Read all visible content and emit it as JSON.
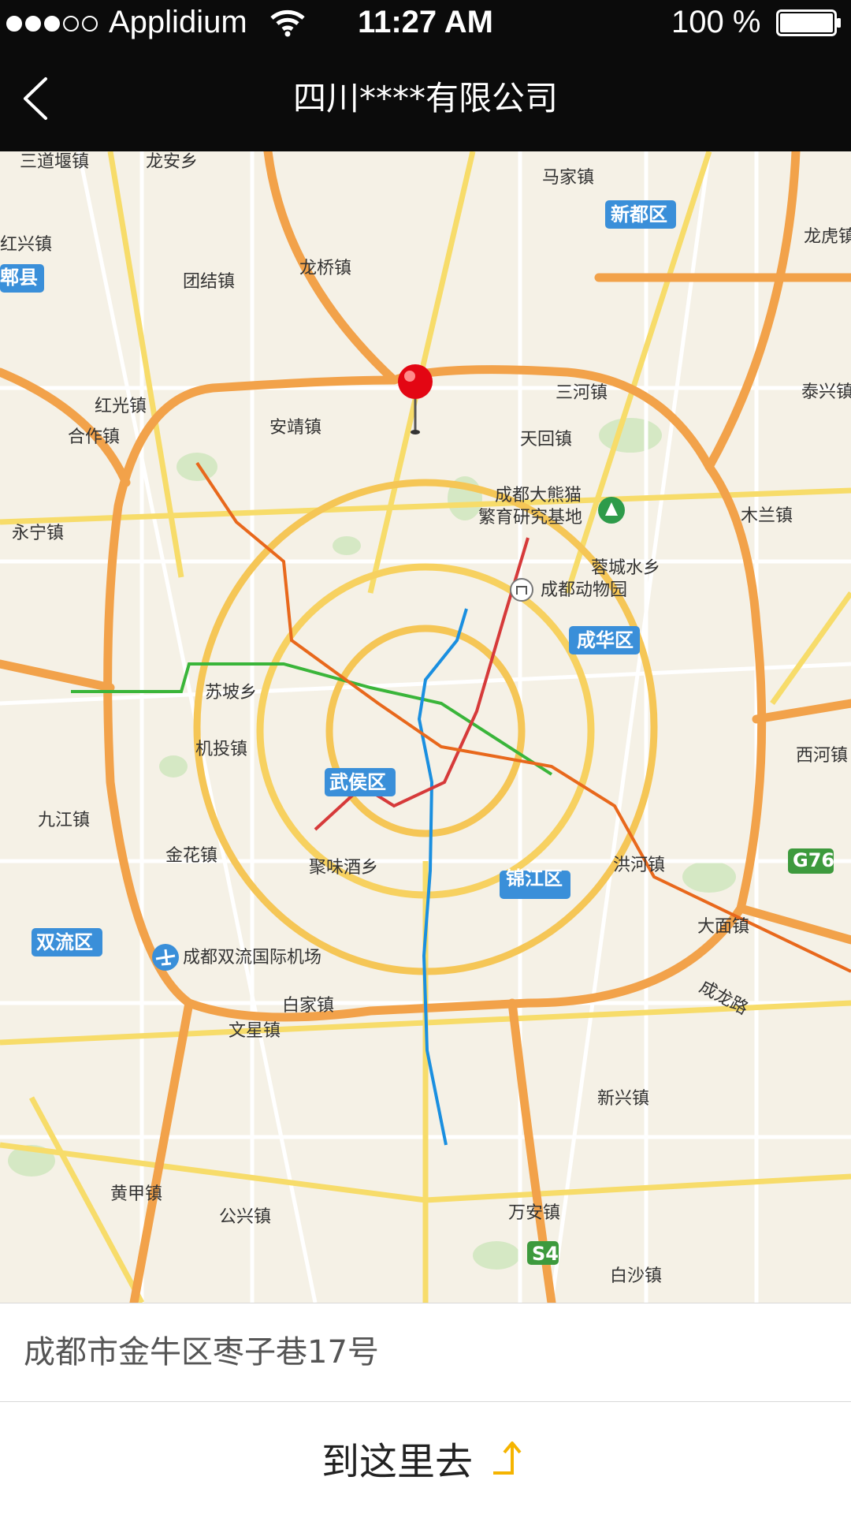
{
  "status_bar": {
    "signal_dots_filled": 3,
    "signal_dots_total": 5,
    "carrier": "Applidium",
    "time": "11:27 AM",
    "battery_text": "100 %",
    "battery_level": 1.0
  },
  "nav_bar": {
    "back_icon": "chevron-left-icon",
    "title": "四川****有限公司"
  },
  "map": {
    "pin_icon": "map-pin-icon",
    "place_labels": [
      "三道堰镇",
      "龙安乡",
      "马家镇",
      "红兴镇",
      "新都区",
      "龙虎镇",
      "团结镇",
      "龙桥镇",
      "郫县",
      "三河镇",
      "泰兴镇",
      "红光镇",
      "安靖镇",
      "合作镇",
      "天回镇",
      "成都大熊猫",
      "繁育研究基地",
      "木兰镇",
      "永宁镇",
      "蓉城水乡",
      "成都动物园",
      "成华区",
      "苏坡乡",
      "机投镇",
      "武侯区",
      "西河镇",
      "九江镇",
      "G76",
      "金花镇",
      "聚味酒乡",
      "锦江区",
      "洪河镇",
      "双流区",
      "成都双流国际机场",
      "大面镇",
      "成龙路",
      "白家镇",
      "文星镇",
      "新兴镇",
      "黄甲镇",
      "公兴镇",
      "万安镇",
      "S4",
      "白沙镇"
    ],
    "colors": {
      "ring_road": "#f2a24a",
      "secondary_road": "#f7dc6a",
      "metro_line_1": "#1a8fe0",
      "metro_line_2": "#d63a3a",
      "metro_line_3": "#3ab53a",
      "metro_line_4": "#e8681c",
      "district_badge": "#3a8fd9",
      "highway_badge": "#3d9a3d"
    }
  },
  "address": {
    "text": "成都市金牛区枣子巷17号"
  },
  "directions": {
    "label": "到这里去",
    "icon": "turn-right-arrow-icon",
    "accent_color": "#f5b400"
  }
}
